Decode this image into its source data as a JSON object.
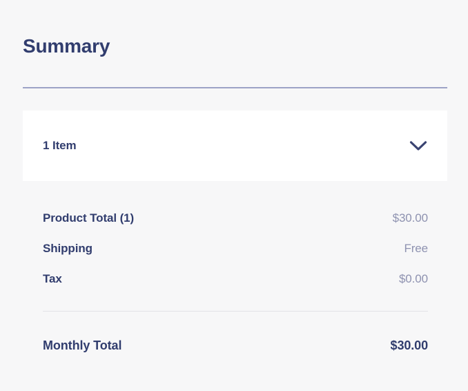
{
  "panel": {
    "title": "Summary",
    "background_color": "#f7f7f8",
    "accent_color": "#313d6e",
    "rule_color": "#9ca2c6"
  },
  "item_card": {
    "label": "1 Item",
    "toggle_icon": "chevron-down-icon",
    "background_color": "#ffffff"
  },
  "lines": [
    {
      "label": "Product Total (1)",
      "value": "$30.00"
    },
    {
      "label": "Shipping",
      "value": "Free"
    },
    {
      "label": "Tax",
      "value": "$0.00"
    }
  ],
  "total": {
    "label": "Monthly Total",
    "value": "$30.00"
  }
}
